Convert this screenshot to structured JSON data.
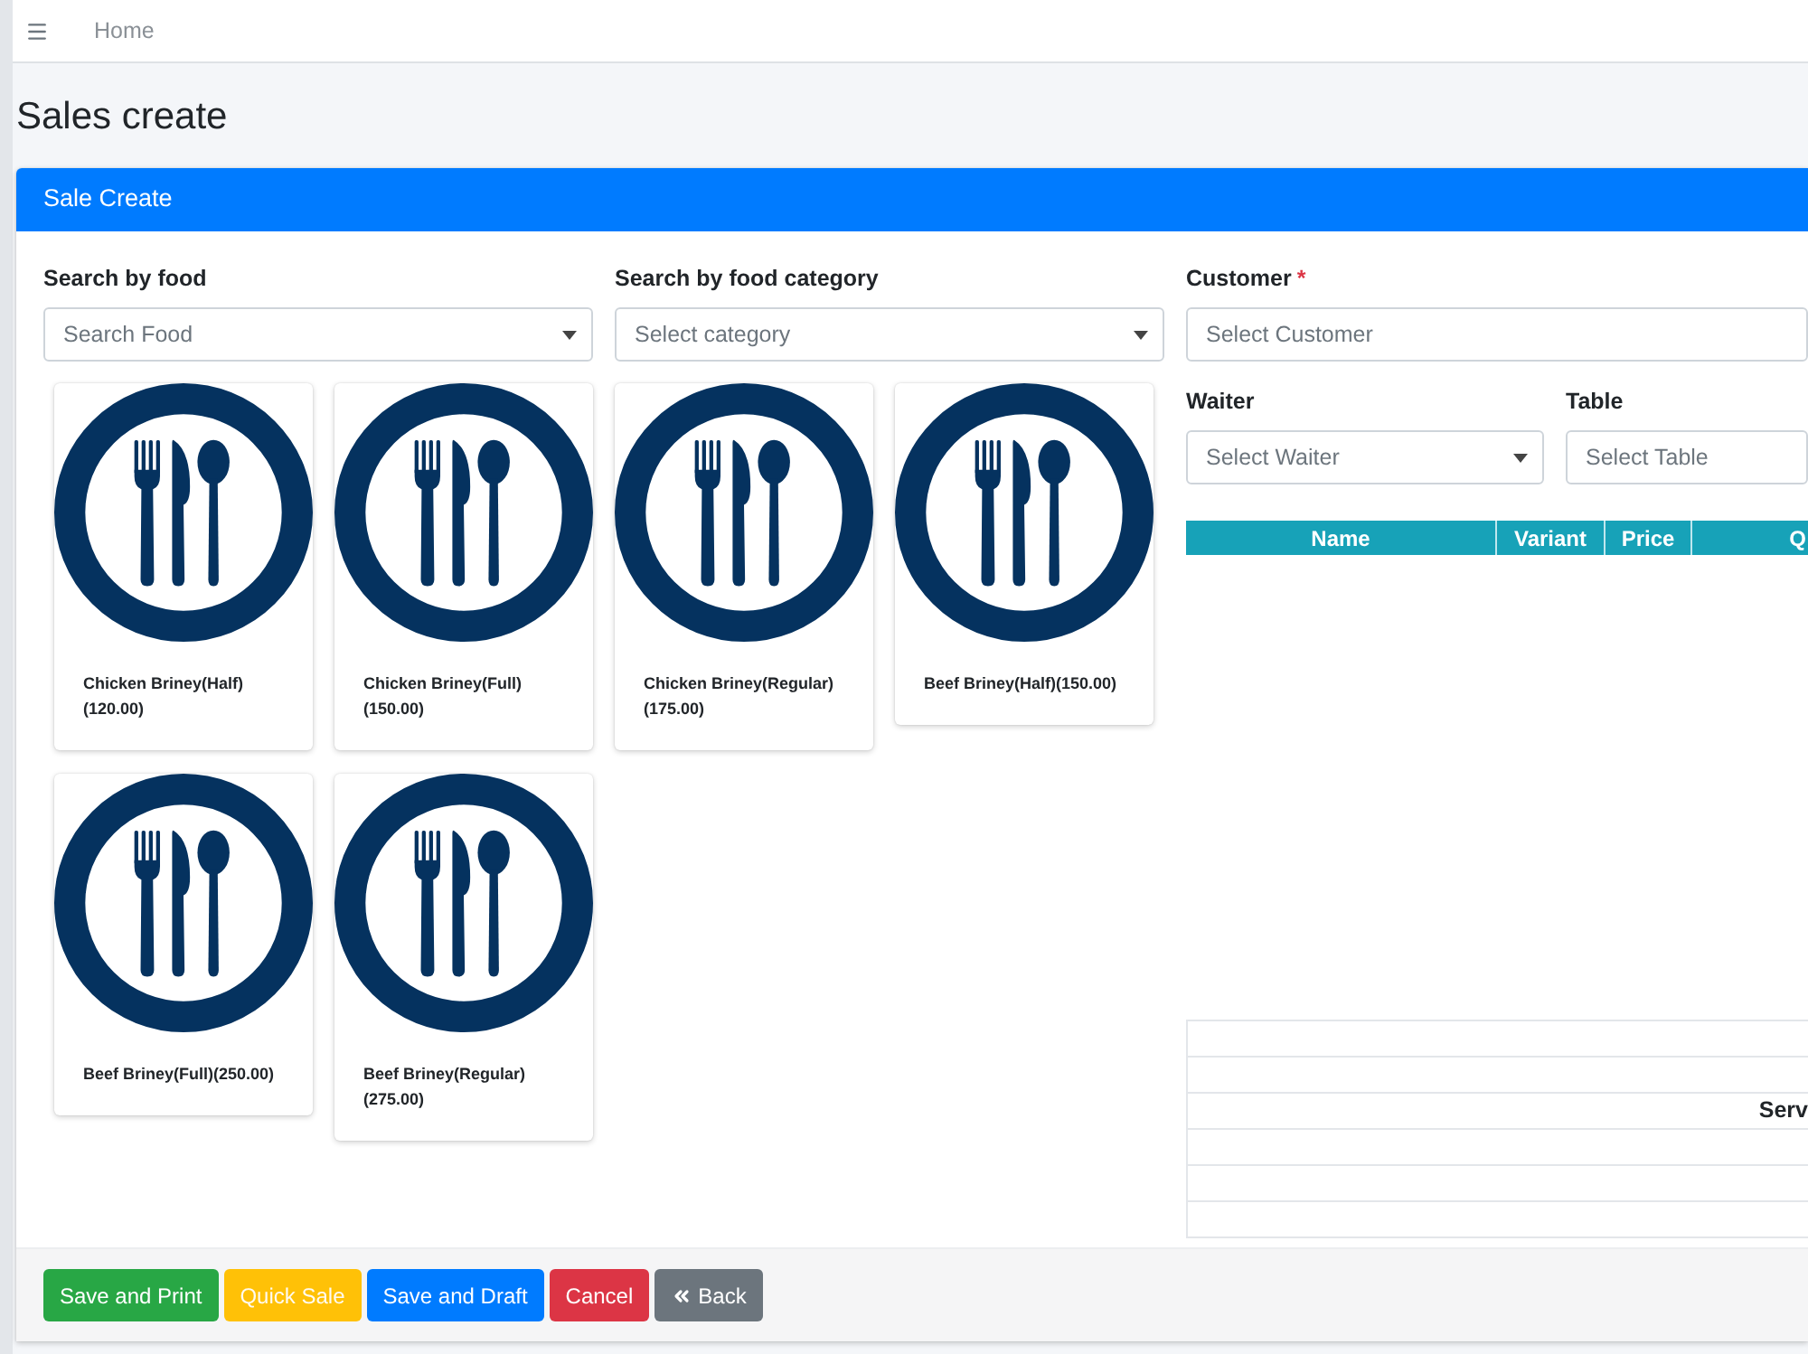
{
  "navbar": {
    "breadcrumb": "Home"
  },
  "page_title": "Sales create",
  "card": {
    "title": "Sale Create",
    "filters": [
      {
        "label": "Search by food",
        "placeholder": "Search Food"
      },
      {
        "label": "Search by food category",
        "placeholder": "Select category"
      }
    ],
    "foods": [
      {
        "label": "Chicken Briney(Half)(120.00)"
      },
      {
        "label": "Chicken Briney(Full)(150.00)"
      },
      {
        "label": "Chicken Briney(Regular)(175.00)"
      },
      {
        "label": "Beef Briney(Half)(150.00)"
      },
      {
        "label": "Beef Briney(Full)(250.00)"
      },
      {
        "label": "Beef Briney(Regular)(275.00)"
      }
    ],
    "customer": {
      "label": "Customer",
      "required_mark": "*",
      "placeholder": "Select Customer"
    },
    "waiter": {
      "label": "Waiter",
      "placeholder": "Select Waiter"
    },
    "table": {
      "label": "Table",
      "placeholder": "Select Table"
    },
    "order_table": {
      "columns": [
        "Name",
        "Variant",
        "Price",
        "Q"
      ]
    },
    "summary_rows": [
      {
        "kind": "blank"
      },
      {
        "kind": "blank"
      },
      {
        "kind": "label",
        "label": "Serv"
      },
      {
        "kind": "blank"
      },
      {
        "kind": "blank"
      },
      {
        "kind": "blank"
      }
    ]
  },
  "buttons": [
    {
      "label": "Save and Print",
      "kind": "success"
    },
    {
      "label": "Quick Sale",
      "kind": "warning"
    },
    {
      "label": "Save and Draft",
      "kind": "primary"
    },
    {
      "label": "Cancel",
      "kind": "danger"
    },
    {
      "label": "Back",
      "kind": "secondary"
    }
  ]
}
